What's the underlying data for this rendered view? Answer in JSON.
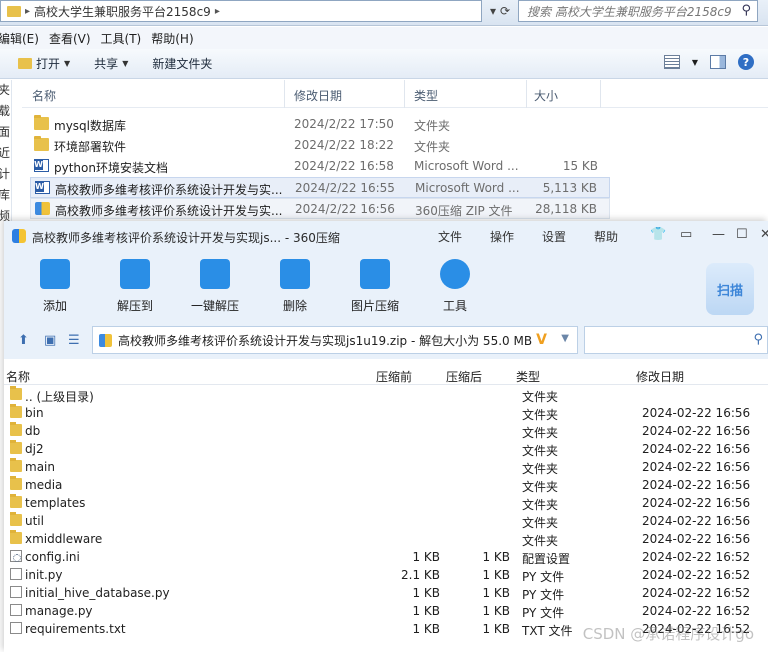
{
  "explorer": {
    "address_path": "高校大学生兼职服务平台2158c9",
    "search_placeholder": "搜索 高校大学生兼职服务平台2158c9",
    "menu": [
      "编辑(E)",
      "查看(V)",
      "工具(T)",
      "帮助(H)"
    ],
    "commands": {
      "open": "打开",
      "share": "共享",
      "new_folder": "新建文件夹"
    },
    "left_strip": [
      "夹",
      "载",
      "面",
      "近",
      "计",
      "库",
      "频"
    ],
    "columns": {
      "name": "名称",
      "date": "修改日期",
      "type": "类型",
      "size": "大小"
    },
    "files": [
      {
        "icon": "folder-icon",
        "name": "mysql数据库",
        "date": "2024/2/22 17:50",
        "type": "文件夹",
        "size": ""
      },
      {
        "icon": "folder-icon",
        "name": "环境部署软件",
        "date": "2024/2/22 18:22",
        "type": "文件夹",
        "size": ""
      },
      {
        "icon": "word-doc-icon",
        "name": "python环境安装文档",
        "date": "2024/2/22 16:58",
        "type": "Microsoft Word ...",
        "size": "15 KB"
      },
      {
        "icon": "word-doc-icon",
        "name": "高校教师多维考核评价系统设计开发与实...",
        "date": "2024/2/22 16:55",
        "type": "Microsoft Word ...",
        "size": "5,113 KB"
      },
      {
        "icon": "zip-archive-icon",
        "name": "高校教师多维考核评价系统设计开发与实...",
        "date": "2024/2/22 16:56",
        "type": "360压缩 ZIP 文件",
        "size": "28,118 KB"
      }
    ]
  },
  "zip": {
    "title": "高校教师多维考核评价系统设计开发与实现js... - 360压缩",
    "menu": [
      "文件",
      "操作",
      "设置",
      "帮助"
    ],
    "tools": [
      "添加",
      "解压到",
      "一键解压",
      "删除",
      "图片压缩",
      "工具"
    ],
    "scan_label": "扫描",
    "path": "高校教师多维考核评价系统设计开发与实现js1u19.zip - 解包大小为 55.0 MB",
    "path_badge": "V",
    "columns": {
      "name": "名称",
      "size": "压缩前",
      "packed": "压缩后",
      "type": "类型",
      "date": "修改日期"
    },
    "entries": [
      {
        "icon": "folder-icon",
        "name": ".. (上级目录)",
        "size": "",
        "packed": "",
        "type": "文件夹",
        "date": ""
      },
      {
        "icon": "folder-icon",
        "name": "bin",
        "size": "",
        "packed": "",
        "type": "文件夹",
        "date": "2024-02-22 16:56"
      },
      {
        "icon": "folder-icon",
        "name": "db",
        "size": "",
        "packed": "",
        "type": "文件夹",
        "date": "2024-02-22 16:56"
      },
      {
        "icon": "folder-icon",
        "name": "dj2",
        "size": "",
        "packed": "",
        "type": "文件夹",
        "date": "2024-02-22 16:56"
      },
      {
        "icon": "folder-icon",
        "name": "main",
        "size": "",
        "packed": "",
        "type": "文件夹",
        "date": "2024-02-22 16:56"
      },
      {
        "icon": "folder-icon",
        "name": "media",
        "size": "",
        "packed": "",
        "type": "文件夹",
        "date": "2024-02-22 16:56"
      },
      {
        "icon": "folder-icon",
        "name": "templates",
        "size": "",
        "packed": "",
        "type": "文件夹",
        "date": "2024-02-22 16:56"
      },
      {
        "icon": "folder-icon",
        "name": "util",
        "size": "",
        "packed": "",
        "type": "文件夹",
        "date": "2024-02-22 16:56"
      },
      {
        "icon": "folder-icon",
        "name": "xmiddleware",
        "size": "",
        "packed": "",
        "type": "文件夹",
        "date": "2024-02-22 16:56"
      },
      {
        "icon": "config-file-icon",
        "name": "config.ini",
        "size": "1 KB",
        "packed": "1 KB",
        "type": "配置设置",
        "date": "2024-02-22 16:52"
      },
      {
        "icon": "file-icon",
        "name": "init.py",
        "size": "2.1 KB",
        "packed": "1 KB",
        "type": "PY 文件",
        "date": "2024-02-22 16:52"
      },
      {
        "icon": "file-icon",
        "name": "initial_hive_database.py",
        "size": "1 KB",
        "packed": "1 KB",
        "type": "PY 文件",
        "date": "2024-02-22 16:52"
      },
      {
        "icon": "file-icon",
        "name": "manage.py",
        "size": "1 KB",
        "packed": "1 KB",
        "type": "PY 文件",
        "date": "2024-02-22 16:52"
      },
      {
        "icon": "file-icon",
        "name": "requirements.txt",
        "size": "1 KB",
        "packed": "1 KB",
        "type": "TXT 文件",
        "date": "2024-02-22 16:52"
      }
    ],
    "watermark": "CSDN @承诺程序设计go"
  }
}
